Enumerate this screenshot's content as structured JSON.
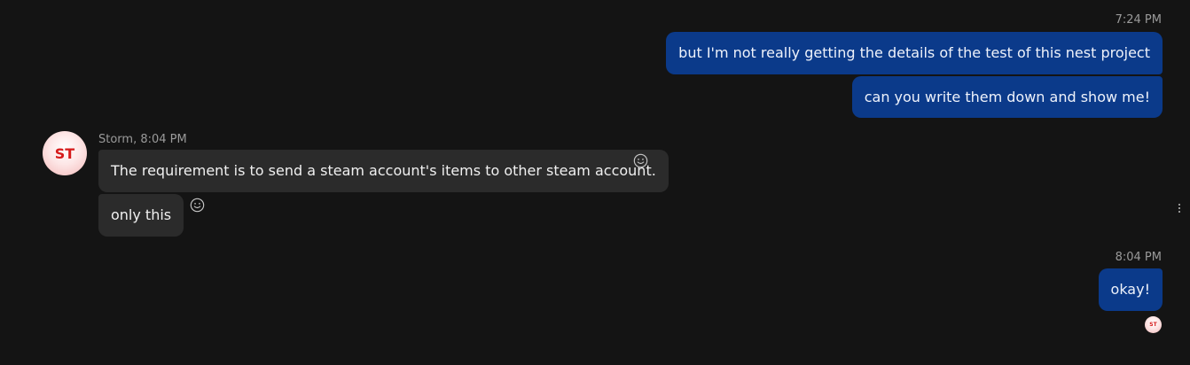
{
  "messages_out_1": {
    "timestamp": "7:24 PM",
    "lines": [
      "but I'm not really getting the details of the test of this nest project",
      "can you write them down and show me!"
    ]
  },
  "messages_in": {
    "sender_header": "Storm, 8:04 PM",
    "avatar_initials": "ST",
    "lines": [
      "The requirement is to send a steam account's items to other steam account.",
      "only this"
    ]
  },
  "messages_out_2": {
    "timestamp": "8:04 PM",
    "lines": [
      "okay!"
    ],
    "read_receipt_initials": "ST"
  },
  "icons": {
    "reaction": "smiley-face-icon",
    "more": "vertical-ellipsis-icon"
  },
  "colors": {
    "background": "#141414",
    "outgoing_bubble": "#0b3a8a",
    "incoming_bubble": "#2b2b2b",
    "avatar_text": "#d61b1b"
  }
}
